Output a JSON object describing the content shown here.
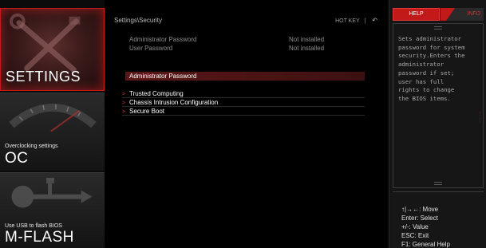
{
  "left_nav": {
    "settings": {
      "title": "SETTINGS"
    },
    "oc": {
      "subtitle": "Overclocking settings",
      "title": "OC"
    },
    "mflash": {
      "subtitle": "Use USB to flash BIOS",
      "title": "M-FLASH"
    }
  },
  "header": {
    "breadcrumb": "Settings\\Security",
    "hotkey_label": "HOT KEY",
    "hotkey_sep": "|",
    "back_symbol": "↶"
  },
  "status": [
    {
      "label": "Administrator Password",
      "value": "Not installed"
    },
    {
      "label": "User Password",
      "value": "Not installed"
    }
  ],
  "selected": {
    "label": "Administrator Password"
  },
  "menu": [
    {
      "arrow": ">",
      "label": "Trusted Computing"
    },
    {
      "arrow": ">",
      "label": "Chassis Intrusion Configuration"
    },
    {
      "arrow": ">",
      "label": "Secure Boot"
    }
  ],
  "help_panel": {
    "tab_help": "HELP",
    "tab_info": "INFO",
    "text": "Sets administrator\npassword for system\nsecurity.Enters the\nadministrator\npassword if set;\nuser has full\nrights to change\nthe BIOS items."
  },
  "keys": [
    "↑|→←: Move",
    "Enter: Select",
    "+/-: Value",
    "ESC: Exit",
    "F1: General Help"
  ],
  "colors": {
    "accent": "#c21919",
    "selected_bg": "#5a1717",
    "muted_text": "#8d8d8d"
  }
}
